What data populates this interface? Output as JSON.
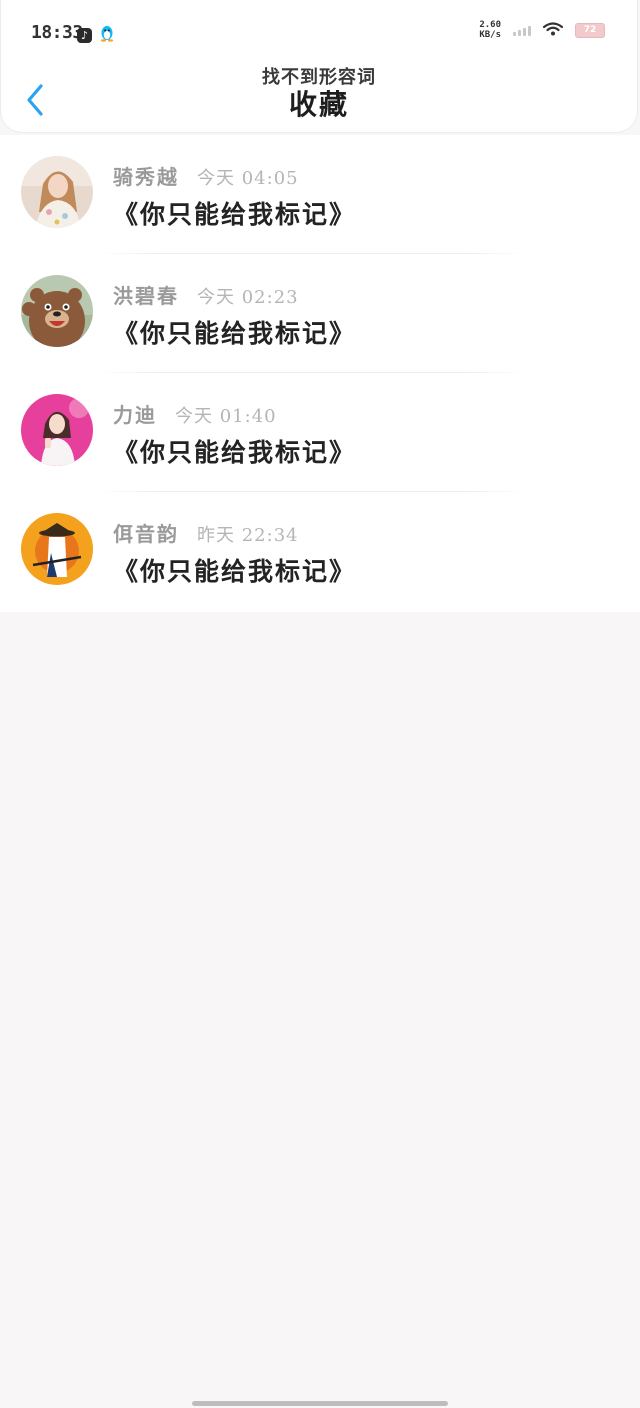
{
  "status_bar": {
    "time": "18:33",
    "net_speed_value": "2.60",
    "net_speed_unit": "KB/s",
    "battery": "72"
  },
  "header": {
    "subtitle": "找不到形容词",
    "title": "收藏"
  },
  "favorites": [
    {
      "name": "骑秀越",
      "time": "今天 04:05",
      "title": "《你只能给我标记》"
    },
    {
      "name": "洪碧春",
      "time": "今天 02:23",
      "title": "《你只能给我标记》"
    },
    {
      "name": "力迪",
      "time": "今天 01:40",
      "title": "《你只能给我标记》"
    },
    {
      "name": "佴音韵",
      "time": "昨天 22:34",
      "title": "《你只能给我标记》"
    }
  ],
  "colors": {
    "accent": "#2aa3f0",
    "background": "#f8f6f7"
  },
  "icons": {
    "back": "chevron-left-icon",
    "tiktok": "tiktok-icon",
    "qq": "qq-penguin-icon",
    "signal": "signal-icon",
    "wifi": "wifi-icon",
    "battery": "battery-icon"
  }
}
